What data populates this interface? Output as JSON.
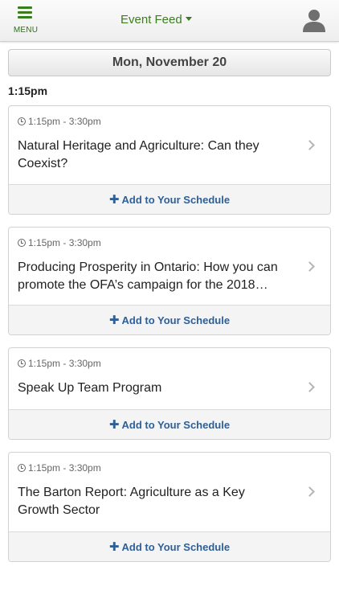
{
  "header": {
    "menu_label": "MENU",
    "feed_title": "Event Feed"
  },
  "date_label": "Mon, November 20",
  "time_group": "1:15pm",
  "events": [
    {
      "time": "1:15pm - 3:30pm",
      "title": "Natural Heritage and Agriculture: Can they Coexist?",
      "action": "Add to Your Schedule"
    },
    {
      "time": "1:15pm - 3:30pm",
      "title": "Producing Prosperity in Ontario: How you can promote the OFA’s campaign for the 2018…",
      "action": "Add to Your Schedule"
    },
    {
      "time": "1:15pm - 3:30pm",
      "title": "Speak Up Team Program",
      "action": "Add to Your Schedule"
    },
    {
      "time": "1:15pm - 3:30pm",
      "title": "The Barton Report: Agriculture as a Key Growth Sector",
      "action": "Add to Your Schedule"
    }
  ],
  "colors": {
    "brand_green": "#3a7d1e",
    "action_blue": "#2e5f96"
  },
  "icons": {
    "menu": "hamburger-icon",
    "user": "user-icon",
    "clock": "clock-icon",
    "chevron": "chevron-right-icon",
    "caret": "caret-down-icon",
    "plus": "plus-icon"
  }
}
